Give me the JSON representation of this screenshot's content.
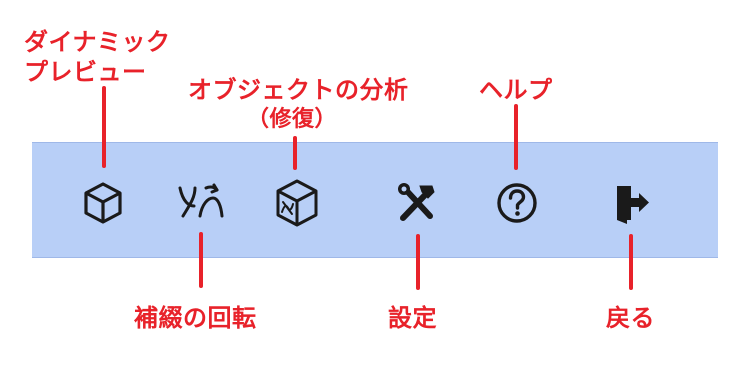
{
  "colors": {
    "toolbar_bg": "#b8cff7",
    "callout": "#e8222a",
    "icon": "#1a1a1a"
  },
  "toolbar": {
    "tools": [
      {
        "id": "dynamic-preview",
        "icon": "cube-icon",
        "label_lines": [
          "ダイナミック",
          "プレビュー"
        ]
      },
      {
        "id": "rotate-interp",
        "icon": "rotate-interpolation-icon",
        "label": "補綴の回転"
      },
      {
        "id": "object-analysis",
        "icon": "object-analysis-icon",
        "label": "オブジェクトの分析",
        "sublabel": "（修復）"
      },
      {
        "id": "settings",
        "icon": "tools-icon",
        "label": "設定"
      },
      {
        "id": "help",
        "icon": "question-circle-icon",
        "label": "ヘルプ"
      },
      {
        "id": "back",
        "icon": "exit-door-icon",
        "label": "戻る"
      }
    ]
  }
}
